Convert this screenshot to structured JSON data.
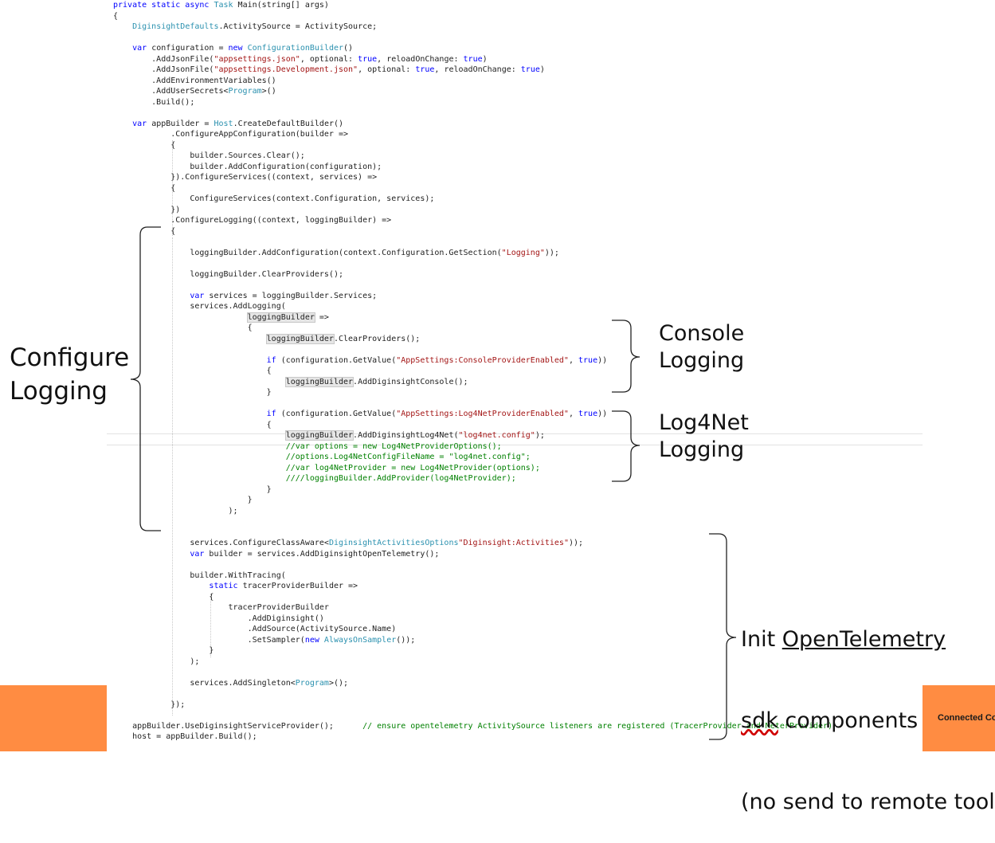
{
  "code_lines": [
    [
      [
        "kw",
        "private static async "
      ],
      [
        "ty",
        "Task "
      ],
      [
        "",
        "Main(string[] args)"
      ]
    ],
    [
      [
        "",
        "{"
      ]
    ],
    [
      [
        "",
        "    "
      ],
      [
        "ty",
        "DiginsightDefaults"
      ],
      [
        "",
        ".ActivitySource = ActivitySource;"
      ]
    ],
    [
      [
        "",
        ""
      ]
    ],
    [
      [
        "",
        "    "
      ],
      [
        "kw",
        "var "
      ],
      [
        "",
        "configuration = "
      ],
      [
        "kw",
        "new "
      ],
      [
        "ty",
        "ConfigurationBuilder"
      ],
      [
        "",
        "()"
      ]
    ],
    [
      [
        "",
        "        .AddJsonFile("
      ],
      [
        "st",
        "\"appsettings.json\""
      ],
      [
        "",
        ", optional: "
      ],
      [
        "kw",
        "true"
      ],
      [
        "",
        ", reloadOnChange: "
      ],
      [
        "kw",
        "true"
      ],
      [
        "",
        ")"
      ]
    ],
    [
      [
        "",
        "        .AddJsonFile("
      ],
      [
        "st",
        "\"appsettings.Development.json\""
      ],
      [
        "",
        ", optional: "
      ],
      [
        "kw",
        "true"
      ],
      [
        "",
        ", reloadOnChange: "
      ],
      [
        "kw",
        "true"
      ],
      [
        "",
        ")"
      ]
    ],
    [
      [
        "",
        "        .AddEnvironmentVariables()"
      ]
    ],
    [
      [
        "",
        "        .AddUserSecrets<"
      ],
      [
        "ty",
        "Program"
      ],
      [
        "",
        ">()"
      ]
    ],
    [
      [
        "",
        "        .Build();"
      ]
    ],
    [
      [
        "",
        ""
      ]
    ],
    [
      [
        "",
        "    "
      ],
      [
        "kw",
        "var "
      ],
      [
        "",
        "appBuilder = "
      ],
      [
        "ty",
        "Host"
      ],
      [
        "",
        ".CreateDefaultBuilder()"
      ]
    ],
    [
      [
        "",
        "            .ConfigureAppConfiguration(builder =>"
      ]
    ],
    [
      [
        "",
        "            {"
      ]
    ],
    [
      [
        "",
        "                builder.Sources.Clear();"
      ]
    ],
    [
      [
        "",
        "                builder.AddConfiguration(configuration);"
      ]
    ],
    [
      [
        "",
        "            }).ConfigureServices((context, services) =>"
      ]
    ],
    [
      [
        "",
        "            {"
      ]
    ],
    [
      [
        "",
        "                ConfigureServices(context.Configuration, services);"
      ]
    ],
    [
      [
        "",
        "            })"
      ]
    ],
    [
      [
        "",
        "            .ConfigureLogging((context, loggingBuilder) =>"
      ]
    ],
    [
      [
        "",
        "            {"
      ]
    ],
    [
      [
        "",
        ""
      ]
    ],
    [
      [
        "",
        "                loggingBuilder.AddConfiguration(context.Configuration.GetSection("
      ],
      [
        "st",
        "\"Logging\""
      ],
      [
        "",
        "));"
      ]
    ],
    [
      [
        "",
        ""
      ]
    ],
    [
      [
        "",
        "                loggingBuilder.ClearProviders();"
      ]
    ],
    [
      [
        "",
        ""
      ]
    ],
    [
      [
        "",
        "                "
      ],
      [
        "kw",
        "var "
      ],
      [
        "",
        "services = loggingBuilder.Services;"
      ]
    ],
    [
      [
        "",
        "                services.AddLogging("
      ]
    ],
    [
      [
        "",
        "                            "
      ],
      [
        "hl",
        "loggingBuilder"
      ],
      [
        "",
        " =>"
      ]
    ],
    [
      [
        "",
        "                            {"
      ]
    ],
    [
      [
        "",
        "                                "
      ],
      [
        "hl",
        "loggingBuilder"
      ],
      [
        "",
        ".ClearProviders();"
      ]
    ],
    [
      [
        "",
        ""
      ]
    ],
    [
      [
        "",
        "                                "
      ],
      [
        "kw",
        "if "
      ],
      [
        "",
        "(configuration.GetValue("
      ],
      [
        "st",
        "\"AppSettings:ConsoleProviderEnabled\""
      ],
      [
        "",
        ", "
      ],
      [
        "kw",
        "true"
      ],
      [
        "",
        "))"
      ]
    ],
    [
      [
        "",
        "                                {"
      ]
    ],
    [
      [
        "",
        "                                    "
      ],
      [
        "hl",
        "loggingBuilder"
      ],
      [
        "",
        ".AddDiginsightConsole();"
      ]
    ],
    [
      [
        "",
        "                                }"
      ]
    ],
    [
      [
        "",
        ""
      ]
    ],
    [
      [
        "",
        "                                "
      ],
      [
        "kw",
        "if "
      ],
      [
        "",
        "(configuration.GetValue("
      ],
      [
        "st",
        "\"AppSettings:Log4NetProviderEnabled\""
      ],
      [
        "",
        ", "
      ],
      [
        "kw",
        "true"
      ],
      [
        "",
        "))"
      ]
    ],
    [
      [
        "",
        "                                {"
      ]
    ],
    [
      [
        "",
        "                                    "
      ],
      [
        "hl",
        "loggingBuilder"
      ],
      [
        "",
        ".AddDiginsightLog4Net("
      ],
      [
        "st",
        "\"log4net.config\""
      ],
      [
        "",
        ");"
      ]
    ],
    [
      [
        "",
        "                                    "
      ],
      [
        "cm",
        "//var options = new Log4NetProviderOptions();"
      ]
    ],
    [
      [
        "",
        "                                    "
      ],
      [
        "cm",
        "//options.Log4NetConfigFileName = \"log4net.config\";"
      ]
    ],
    [
      [
        "",
        "                                    "
      ],
      [
        "cm",
        "//var log4NetProvider = new Log4NetProvider(options);"
      ]
    ],
    [
      [
        "",
        "                                    "
      ],
      [
        "cm",
        "////loggingBuilder.AddProvider(log4NetProvider);"
      ]
    ],
    [
      [
        "",
        "                                }"
      ]
    ],
    [
      [
        "",
        "                            }"
      ]
    ],
    [
      [
        "",
        "                        );"
      ]
    ],
    [
      [
        "",
        ""
      ]
    ],
    [
      [
        "",
        ""
      ]
    ],
    [
      [
        "",
        "                services.ConfigureClassAware<"
      ],
      [
        "ty",
        "DiginsightActivitiesOptions"
      ],
      [
        ">(configuration.GetSection("
      ],
      [
        "st",
        "\"Diginsight:Activities\""
      ],
      [
        "",
        "));"
      ]
    ],
    [
      [
        "",
        "                "
      ],
      [
        "kw",
        "var "
      ],
      [
        "",
        "builder = services.AddDiginsightOpenTelemetry();"
      ]
    ],
    [
      [
        "",
        ""
      ]
    ],
    [
      [
        "",
        "                builder.WithTracing("
      ]
    ],
    [
      [
        "",
        "                    "
      ],
      [
        "kw",
        "static "
      ],
      [
        "",
        "tracerProviderBuilder =>"
      ]
    ],
    [
      [
        "",
        "                    {"
      ]
    ],
    [
      [
        "",
        "                        tracerProviderBuilder"
      ]
    ],
    [
      [
        "",
        "                            .AddDiginsight()"
      ]
    ],
    [
      [
        "",
        "                            .AddSource(ActivitySource.Name)"
      ]
    ],
    [
      [
        "",
        "                            .SetSampler("
      ],
      [
        "kw",
        "new "
      ],
      [
        "ty",
        "AlwaysOnSampler"
      ],
      [
        "",
        "());"
      ]
    ],
    [
      [
        "",
        "                    }"
      ]
    ],
    [
      [
        "",
        "                );"
      ]
    ],
    [
      [
        "",
        ""
      ]
    ],
    [
      [
        "",
        "                services.AddSingleton<"
      ],
      [
        "ty",
        "Program"
      ],
      [
        "",
        ">();"
      ]
    ],
    [
      [
        "",
        ""
      ]
    ],
    [
      [
        "",
        "            });"
      ]
    ],
    [
      [
        "",
        ""
      ]
    ],
    [
      [
        "",
        "    appBuilder.UseDiginsightServiceProvider();      "
      ],
      [
        "cm",
        "// ensure opentelemetry ActivitySource listeners are registered (TracerProvider and MeterProvider)"
      ]
    ],
    [
      [
        "",
        "    host = appBuilder.Build();"
      ]
    ]
  ],
  "annotations": {
    "configure_logging": [
      "Configure",
      "Logging"
    ],
    "console_logging": [
      "Console",
      "Logging"
    ],
    "log4net_logging": [
      "Log4Net",
      "Logging"
    ],
    "init_otel": {
      "line1_a": "Init ",
      "line1_b": "OpenTelemetry",
      "line2_a": "sdk",
      "line2_b": " components",
      "line3": "(no send to remote tools)"
    }
  },
  "footer": {
    "corner_text": "Connected Co"
  },
  "colors": {
    "accent": "#FF8C42",
    "keyword": "#0000ff",
    "type": "#2b91af",
    "string": "#a31515",
    "comment": "#008000"
  }
}
